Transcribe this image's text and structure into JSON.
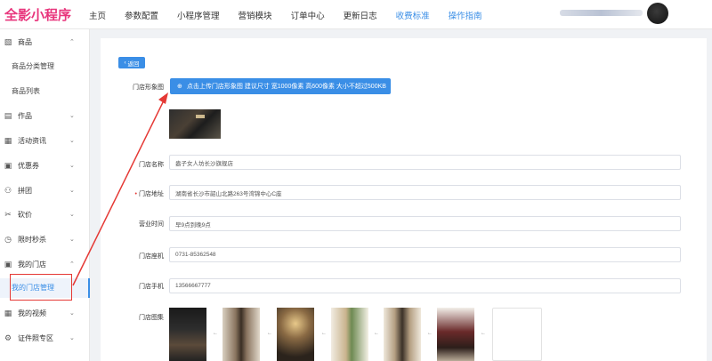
{
  "header": {
    "logo": "全影小程序",
    "nav": [
      "主页",
      "参数配置",
      "小程序管理",
      "营销模块",
      "订单中心",
      "更新日志",
      "收费标准",
      "操作指南"
    ]
  },
  "sidebar": {
    "items": [
      {
        "label": "商品",
        "icon": "bag-icon",
        "chevron": "⌃"
      },
      {
        "label": "商品分类管理"
      },
      {
        "label": "商品列表"
      },
      {
        "label": "作品",
        "icon": "image-icon",
        "chevron": "⌄"
      },
      {
        "label": "活动资讯",
        "icon": "news-icon",
        "chevron": "⌄"
      },
      {
        "label": "优惠券",
        "icon": "coupon-icon",
        "chevron": "⌄"
      },
      {
        "label": "拼团",
        "icon": "group-icon",
        "chevron": "⌄"
      },
      {
        "label": "砍价",
        "icon": "scissors-icon",
        "chevron": "⌄"
      },
      {
        "label": "限时秒杀",
        "icon": "clock-icon",
        "chevron": "⌄"
      },
      {
        "label": "我的门店",
        "icon": "store-icon",
        "chevron": "⌃"
      },
      {
        "label": "我的门店管理"
      },
      {
        "label": "我的视频",
        "icon": "video-icon",
        "chevron": "⌄"
      },
      {
        "label": "证件照专区",
        "icon": "id-photo-icon",
        "chevron": "⌄"
      }
    ]
  },
  "form": {
    "back_label": "返回",
    "image_label": "门店形象图",
    "upload_label": "点击上传门店形象图 建议尺寸 宽1000像素 高600像素 大小不超过500KB",
    "name_label": "门店名称",
    "name_value": "盎子女人坊长沙旗舰店",
    "address_label": "门店地址",
    "address_value": "湖南省长沙市韶山北路263号湾锦中心C座",
    "hours_label": "营业时间",
    "hours_value": "早9点到晚9点",
    "phone_label": "门店座机",
    "phone_value": "0731-85362548",
    "mobile_label": "门店手机",
    "mobile_value": "13566667777",
    "gallery_label": "门店图集"
  },
  "colors": {
    "accent": "#3a8ee6",
    "logo": "#e8357c",
    "annotation": "#e53935"
  }
}
